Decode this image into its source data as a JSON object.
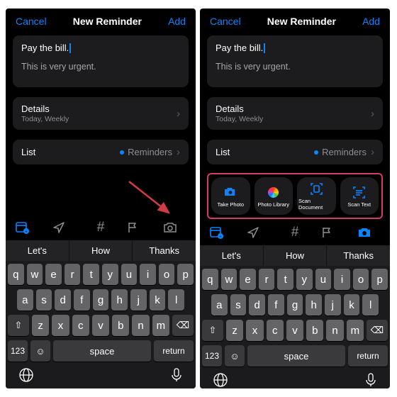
{
  "nav": {
    "cancel": "Cancel",
    "title": "New Reminder",
    "add": "Add"
  },
  "note": {
    "title": "Pay the bill.",
    "body": "This is very urgent."
  },
  "details": {
    "label": "Details",
    "sub": "Today, Weekly"
  },
  "list": {
    "label": "List",
    "value": "Reminders"
  },
  "attach": {
    "takePhoto": "Take Photo",
    "photoLibrary": "Photo Library",
    "scanDocument": "Scan Document",
    "scanText": "Scan Text"
  },
  "suggestions": {
    "a": "Let's",
    "b": "How",
    "c": "Thanks"
  },
  "keys": {
    "r1": [
      "q",
      "w",
      "e",
      "r",
      "t",
      "y",
      "u",
      "i",
      "o",
      "p"
    ],
    "r2": [
      "a",
      "s",
      "d",
      "f",
      "g",
      "h",
      "j",
      "k",
      "l"
    ],
    "r3": [
      "z",
      "x",
      "c",
      "v",
      "b",
      "n",
      "m"
    ],
    "num": "123",
    "space": "space",
    "return": "return"
  }
}
